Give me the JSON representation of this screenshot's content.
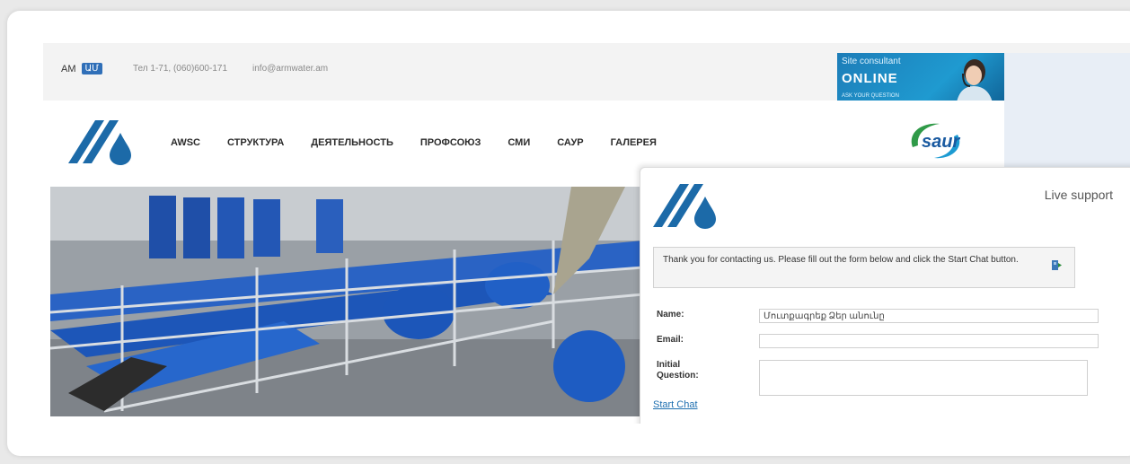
{
  "topbar": {
    "lang_inactive": "AM",
    "lang_active": "ԱՄ",
    "phone": "Тел 1-71, (060)600-171",
    "email": "info@armwater.am"
  },
  "banner": {
    "line1": "Site consultant",
    "line2": "ONLINE",
    "line3": "ASK YOUR QUESTION"
  },
  "nav": {
    "items": [
      "AWSC",
      "СТРУКТУРА",
      "ДЕЯТЕЛЬНОСТЬ",
      "ПРОФСОЮЗ",
      "СМИ",
      "САУР",
      "ГАЛЕРЕЯ"
    ]
  },
  "partner_logo": "saur",
  "chat": {
    "title": "Live support",
    "message": "Thank you for contacting us. Please fill out the form below and click the Start Chat button.",
    "name_label": "Name:",
    "name_value": "Մուտքագրեք Ձեր անունը",
    "email_label": "Email:",
    "email_value": "",
    "question_label_1": "Initial",
    "question_label_2": "Question:",
    "start_label": "Start Chat"
  },
  "colors": {
    "brand_blue": "#1c6aa8",
    "accent_blue": "#2f6fb8",
    "link_blue": "#1e6fb0"
  }
}
